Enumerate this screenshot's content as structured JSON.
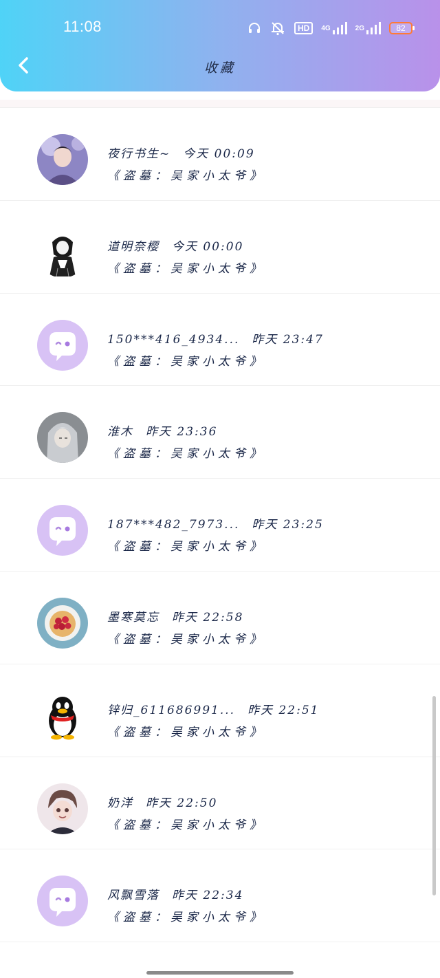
{
  "status_bar": {
    "time": "11:08",
    "hd_label": "HD",
    "network_1": "4G",
    "network_2": "2G",
    "battery": "82",
    "icons": [
      "headset-icon",
      "mute-bell-icon",
      "hd-icon",
      "signal-4g-icon",
      "signal-2g-icon",
      "battery-icon"
    ]
  },
  "header": {
    "title": "收藏",
    "back_icon": "chevron-left-icon",
    "colors": {
      "gradient_start": "#4fd3f7",
      "gradient_end": "#b991ea"
    }
  },
  "items": [
    {
      "name": "夜行书生~",
      "time": "今天 00:09",
      "message": "《盗墓：吴家小太爷》",
      "avatar": "avatar-photo-boy"
    },
    {
      "name": "道明奈樱",
      "time": "今天 00:00",
      "message": "《盗墓：吴家小太爷》",
      "avatar": "avatar-sketch-girl"
    },
    {
      "name": "150***416_4934...",
      "time": "昨天 23:47",
      "message": "《盗墓：吴家小太爷》",
      "avatar": "avatar-default-chat"
    },
    {
      "name": "淮木",
      "time": "昨天 23:36",
      "message": "《盗墓：吴家小太爷》",
      "avatar": "avatar-anime-longhair"
    },
    {
      "name": "187***482_7973...",
      "time": "昨天 23:25",
      "message": "《盗墓：吴家小太爷》",
      "avatar": "avatar-default-chat"
    },
    {
      "name": "墨寒莫忘",
      "time": "昨天 22:58",
      "message": "《盗墓：吴家小太爷》",
      "avatar": "avatar-cake"
    },
    {
      "name": "锌归_611686991...",
      "time": "昨天 22:51",
      "message": "《盗墓：吴家小太爷》",
      "avatar": "avatar-penguin"
    },
    {
      "name": "奶洋",
      "time": "昨天 22:50",
      "message": "《盗墓：吴家小太爷》",
      "avatar": "avatar-anime-boy"
    },
    {
      "name": "风飘雪落",
      "time": "昨天 22:34",
      "message": "《盗墓：吴家小太爷》",
      "avatar": "avatar-default-chat"
    }
  ]
}
